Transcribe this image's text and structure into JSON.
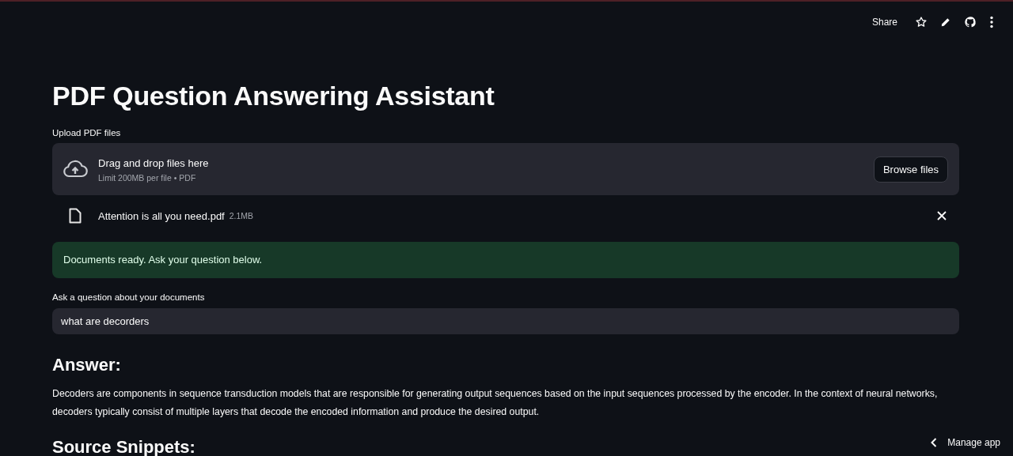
{
  "toolbar": {
    "share": "Share"
  },
  "title": "PDF Question Answering Assistant",
  "uploader": {
    "label": "Upload PDF files",
    "dropzone_title": "Drag and drop files here",
    "dropzone_hint": "Limit 200MB per file • PDF",
    "browse_button": "Browse files",
    "files": [
      {
        "name": "Attention is all you need.pdf",
        "size": "2.1MB"
      }
    ]
  },
  "status": {
    "kind": "success",
    "message": "Documents ready. Ask your question below."
  },
  "question": {
    "label": "Ask a question about your documents",
    "value": "what are decorders"
  },
  "answer": {
    "heading": "Answer:",
    "text": "Decoders are components in sequence transduction models that are responsible for generating output sequences based on the input sequences processed by the encoder. In the context of neural networks, decoders typically consist of multiple layers that decode the encoded information and produce the desired output."
  },
  "sources": {
    "heading": "Source Snippets:"
  },
  "manage_app": "Manage app"
}
